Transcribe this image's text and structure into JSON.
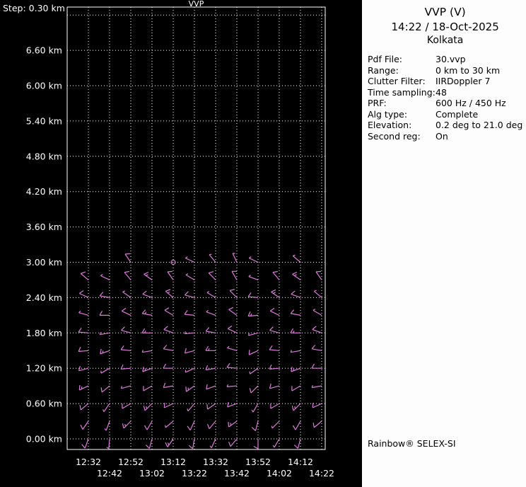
{
  "panel": {
    "title": "VVP (V)",
    "datetime": "14:22 / 18-Oct-2025",
    "site": "Kolkata",
    "rows": [
      {
        "label": "Pdf File:",
        "value": "30.vvp"
      },
      {
        "label": "Range:",
        "value": "0 km to 30 km"
      },
      {
        "label": "Clutter Filter:",
        "value": "IIRDoppler 7"
      },
      {
        "label": "Time sampling:",
        "value": "48"
      },
      {
        "label": "PRF:",
        "value": "600 Hz / 450 Hz"
      },
      {
        "label": "Alg type:",
        "value": "Complete"
      },
      {
        "label": "Elevation:",
        "value": "0.2 deg to 21.0 deg"
      },
      {
        "label": "Second reg:",
        "value": "On"
      }
    ],
    "footer": "Rainbow® SELEX-SI"
  },
  "chart_data": {
    "type": "wind-barb-time-height",
    "title": "VVP",
    "step_label": "Step: 0.30 km",
    "x_ticks": [
      "12:32",
      "12:42",
      "12:52",
      "13:02",
      "13:12",
      "13:22",
      "13:32",
      "13:42",
      "13:52",
      "14:02",
      "14:12",
      "14:22"
    ],
    "y_tick_labels": [
      "6.60 km",
      "6.00 km",
      "5.40 km",
      "4.80 km",
      "4.20 km",
      "3.60 km",
      "3.00 km",
      "2.40 km",
      "1.80 km",
      "1.20 km",
      "0.60 km",
      "0.00 km"
    ],
    "y_tick_values_km": [
      6.6,
      6.0,
      5.4,
      4.8,
      4.2,
      3.6,
      3.0,
      2.4,
      1.8,
      1.2,
      0.6,
      0.0
    ],
    "height_step_km": 0.3,
    "y_top_km": 7.2,
    "grid": "dotted",
    "legend": "none",
    "colors": {
      "background": "#000000",
      "grid": "#ffffff",
      "text": "#ffffff",
      "barb": "#dd7add",
      "panel_bg": "#fdfdfd",
      "panel_text": "#000000"
    },
    "barb_units": "knots, [direction_deg, speed_kt], C = calm circle, null = no data",
    "barb_rows": [
      {
        "h_km": 3.0,
        "cells": [
          null,
          null,
          [
            325,
            10
          ],
          null,
          "C",
          [
            295,
            5
          ],
          [
            320,
            5
          ],
          [
            335,
            5
          ],
          [
            295,
            5
          ],
          null,
          [
            310,
            5
          ],
          null
        ]
      },
      {
        "h_km": 2.7,
        "cells": [
          [
            310,
            10
          ],
          [
            295,
            5
          ],
          [
            320,
            10
          ],
          [
            305,
            15
          ],
          [
            325,
            10
          ],
          [
            300,
            5
          ],
          [
            315,
            10
          ],
          [
            330,
            10
          ],
          [
            290,
            5
          ],
          [
            320,
            10
          ],
          [
            305,
            15
          ],
          [
            325,
            10
          ]
        ]
      },
      {
        "h_km": 2.4,
        "cells": [
          [
            295,
            10
          ],
          [
            280,
            10
          ],
          [
            305,
            5
          ],
          [
            290,
            10
          ],
          [
            310,
            15
          ],
          [
            285,
            10
          ],
          [
            300,
            5
          ],
          [
            315,
            10
          ],
          [
            275,
            10
          ],
          [
            305,
            15
          ],
          [
            290,
            10
          ],
          [
            310,
            5
          ]
        ]
      },
      {
        "h_km": 2.1,
        "cells": [
          [
            285,
            5
          ],
          [
            270,
            10
          ],
          [
            295,
            10
          ],
          [
            280,
            15
          ],
          [
            300,
            10
          ],
          [
            275,
            10
          ],
          [
            290,
            5
          ],
          [
            305,
            10
          ],
          [
            265,
            15
          ],
          [
            295,
            10
          ],
          [
            280,
            10
          ],
          [
            300,
            5
          ]
        ]
      },
      {
        "h_km": 1.8,
        "cells": [
          [
            275,
            10
          ],
          [
            260,
            5
          ],
          [
            285,
            10
          ],
          [
            270,
            15
          ],
          [
            290,
            10
          ],
          [
            265,
            5
          ],
          [
            280,
            10
          ],
          [
            295,
            10
          ],
          [
            255,
            5
          ],
          [
            285,
            10
          ],
          [
            270,
            15
          ],
          [
            290,
            10
          ]
        ]
      },
      {
        "h_km": 1.5,
        "cells": [
          [
            265,
            10
          ],
          [
            250,
            15
          ],
          [
            275,
            10
          ],
          [
            260,
            5
          ],
          [
            280,
            10
          ],
          [
            255,
            10
          ],
          [
            270,
            15
          ],
          [
            285,
            5
          ],
          [
            245,
            10
          ],
          [
            275,
            10
          ],
          [
            260,
            5
          ],
          [
            280,
            10
          ]
        ]
      },
      {
        "h_km": 1.2,
        "cells": [
          [
            255,
            10
          ],
          [
            240,
            5
          ],
          [
            265,
            10
          ],
          [
            250,
            15
          ],
          [
            270,
            10
          ],
          [
            245,
            5
          ],
          [
            260,
            10
          ],
          [
            275,
            10
          ],
          [
            235,
            5
          ],
          [
            265,
            10
          ],
          [
            250,
            15
          ],
          [
            270,
            10
          ]
        ]
      },
      {
        "h_km": 0.9,
        "cells": [
          [
            245,
            15
          ],
          [
            230,
            10
          ],
          [
            255,
            5
          ],
          [
            240,
            10
          ],
          [
            260,
            10
          ],
          [
            235,
            15
          ],
          [
            250,
            10
          ],
          [
            265,
            5
          ],
          [
            225,
            10
          ],
          [
            255,
            10
          ],
          [
            240,
            10
          ],
          [
            260,
            5
          ]
        ]
      },
      {
        "h_km": 0.6,
        "cells": [
          [
            230,
            10
          ],
          [
            215,
            5
          ],
          [
            240,
            10
          ],
          [
            225,
            15
          ],
          [
            245,
            10
          ],
          [
            220,
            5
          ],
          [
            235,
            10
          ],
          [
            250,
            10
          ],
          [
            210,
            5
          ],
          [
            240,
            10
          ],
          [
            225,
            15
          ],
          [
            245,
            10
          ]
        ]
      },
      {
        "h_km": 0.3,
        "cells": [
          [
            215,
            10
          ],
          [
            200,
            5
          ],
          [
            225,
            15
          ],
          [
            210,
            10
          ],
          [
            230,
            5
          ],
          [
            205,
            10
          ],
          [
            220,
            10
          ],
          [
            235,
            15
          ],
          [
            195,
            10
          ],
          [
            225,
            5
          ],
          [
            210,
            10
          ],
          [
            230,
            10
          ]
        ]
      },
      {
        "h_km": 0.0,
        "cells": [
          [
            200,
            10
          ],
          [
            185,
            5
          ],
          null,
          [
            195,
            10
          ],
          [
            215,
            15
          ],
          [
            190,
            10
          ],
          [
            205,
            5
          ],
          [
            220,
            10
          ],
          [
            180,
            10
          ],
          [
            210,
            5
          ],
          [
            195,
            10
          ],
          null
        ]
      }
    ]
  }
}
